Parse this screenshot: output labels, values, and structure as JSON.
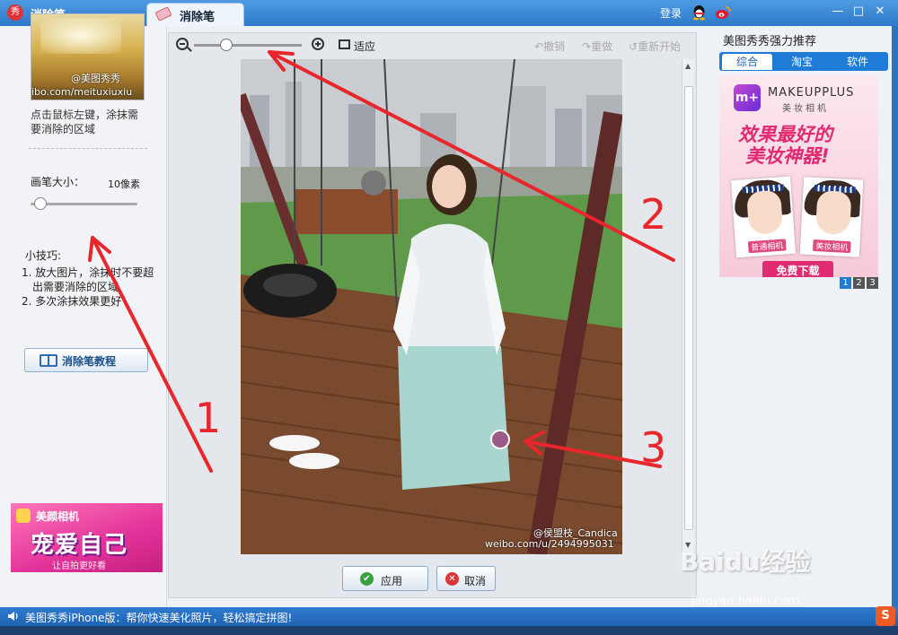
{
  "app": {
    "title": "消除笔",
    "tab_label": "消除笔",
    "login": "登录"
  },
  "left": {
    "thumbnail_watermark_name": "@美图秀秀",
    "thumbnail_watermark_url": "ibo.com/meituxiuxiu",
    "hint": "点击鼠标左键，涂抹需要消除的区域",
    "brush_label": "画笔大小：",
    "brush_value": "10像素",
    "brush_size_px": 10,
    "tips_title": "小技巧:",
    "tips": [
      "1. 放大图片，涂抹时不要超出需要消除的区域",
      "2. 多次涂抹效果更好"
    ],
    "tutorial_button": "消除笔教程",
    "ad": {
      "title": "美颜相机",
      "big_text": "宠爱自己",
      "sub_text": "让自拍更好看"
    }
  },
  "toolbar": {
    "fit_label": "适应",
    "undo_label": "撤销",
    "redo_label": "重做",
    "reset_label": "重新开始",
    "zoom_level_fraction": 0.3
  },
  "photo": {
    "watermark_name": "@侯盟枝_Candica",
    "watermark_url": "weibo.com/u/2494995031"
  },
  "annotations": {
    "label_1": "1",
    "label_2": "2",
    "label_3": "3",
    "color": "#e8262b"
  },
  "actions": {
    "apply": "应用",
    "cancel": "取消"
  },
  "right": {
    "title": "美图秀秀强力推荐",
    "tabs": [
      "综合",
      "淘宝",
      "软件"
    ],
    "active_tab": "综合",
    "ad": {
      "logo": "m+",
      "brand": "MAKEUPPLUS",
      "brand_sub": "美妆相机",
      "slogan_line1": "效果最好的",
      "slogan_line2": "美妆神器!",
      "left_tag": "普通相机",
      "right_tag": "美妆相机",
      "download": "免费下载"
    },
    "pager": [
      "1",
      "2",
      "3"
    ]
  },
  "status": {
    "text": "美图秀秀iPhone版：帮你快速美化照片，轻松搞定拼图!"
  },
  "watermark": {
    "baidu": "Baidu经验",
    "url": "jingyan.baidu.com",
    "sogou": "S"
  }
}
